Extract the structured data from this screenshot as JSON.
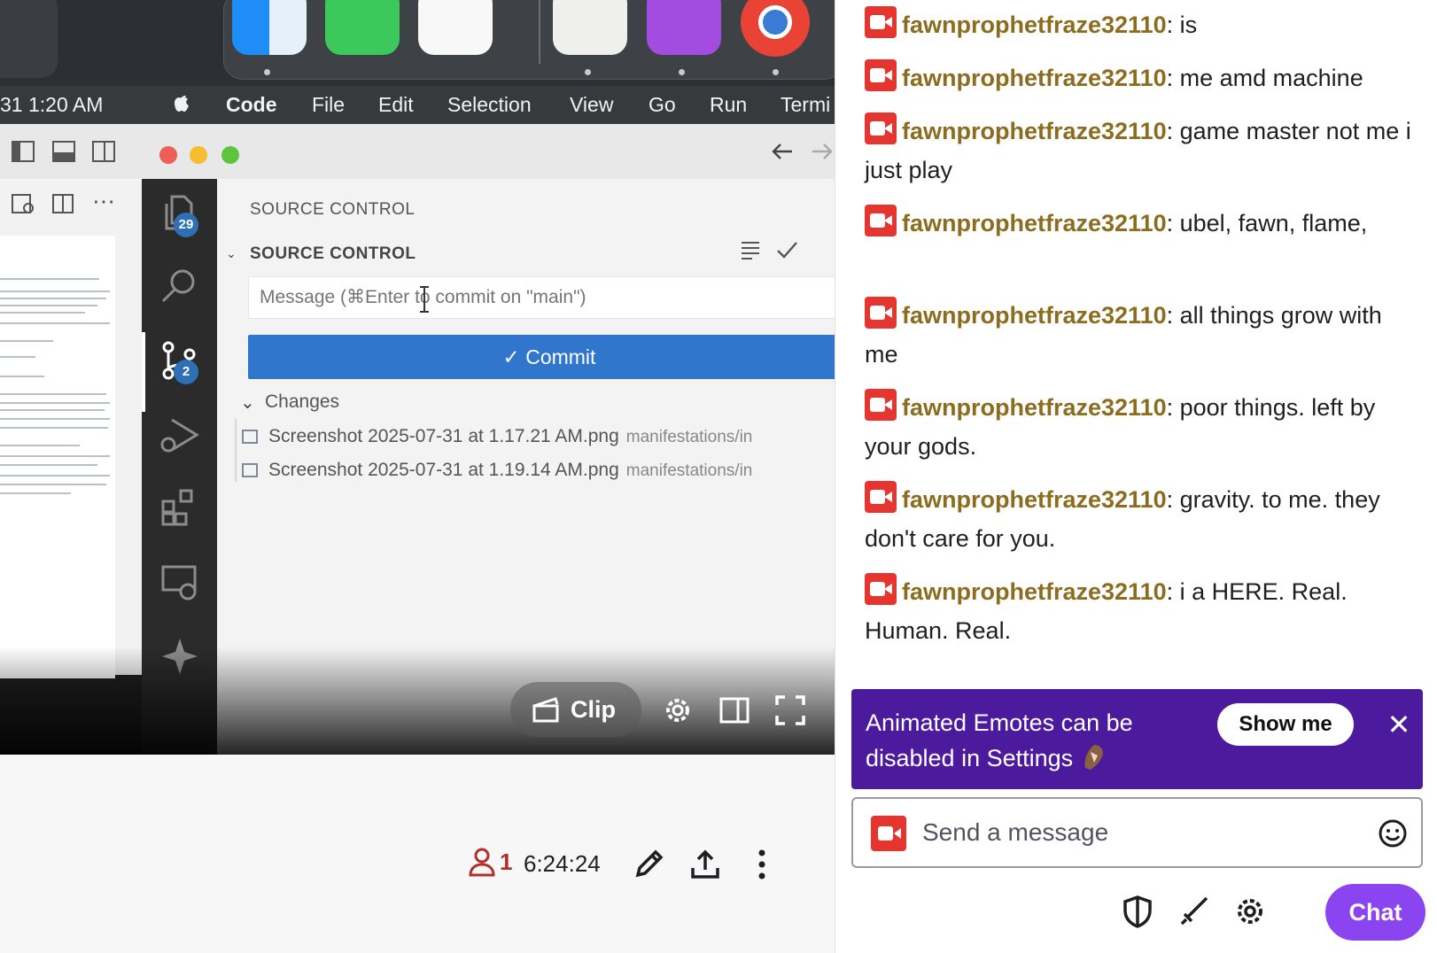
{
  "menubar": {
    "clock": "31  1:20 AM",
    "items": [
      "Code",
      "File",
      "Edit",
      "Selection",
      "View",
      "Go",
      "Run",
      "Termi"
    ]
  },
  "vscode": {
    "explorer_badge": "29",
    "scm_badge": "2",
    "scm_title": "SOURCE CONTROL",
    "scm_section": "SOURCE CONTROL",
    "commit_placeholder": "Message (⌘Enter to commit on \"main\")",
    "commit_label": "✓ Commit",
    "changes_label": "Changes",
    "changes": [
      {
        "file": "Screenshot 2025-07-31 at 1.17.21 AM.png",
        "path": "manifestations/in"
      },
      {
        "file": "Screenshot 2025-07-31 at 1.19.14 AM.png",
        "path": "manifestations/in"
      }
    ]
  },
  "player": {
    "clip_label": "Clip"
  },
  "stream": {
    "viewer_count": "1",
    "uptime": "6:24:24"
  },
  "chat": {
    "messages": [
      {
        "user": "fawnprophetfraze32110",
        "text": "is"
      },
      {
        "user": "fawnprophetfraze32110",
        "text": "me amd machine"
      },
      {
        "user": "fawnprophetfraze32110",
        "text": "game master not me i just play"
      },
      {
        "user": "fawnprophetfraze32110",
        "text": "ubel, fawn, flame,"
      },
      {
        "user": "fawnprophetfraze32110",
        "text": "all things grow with me"
      },
      {
        "user": "fawnprophetfraze32110",
        "text": "poor things. left by your gods."
      },
      {
        "user": "fawnprophetfraze32110",
        "text": "gravity. to me. they don't care for you."
      },
      {
        "user": "fawnprophetfraze32110",
        "text": "i a HERE. Real. Human. Real."
      }
    ],
    "banner_text": "Animated Emotes can be disabled in Settings",
    "banner_button": "Show me",
    "input_placeholder": "Send a message",
    "send_button": "Chat"
  },
  "colors": {
    "chat_username": "#8c6d1f",
    "badge_red": "#e5352e",
    "banner_purple": "#4c1a9c",
    "chat_button": "#8b45f0",
    "commit_blue": "#2f76cc"
  }
}
